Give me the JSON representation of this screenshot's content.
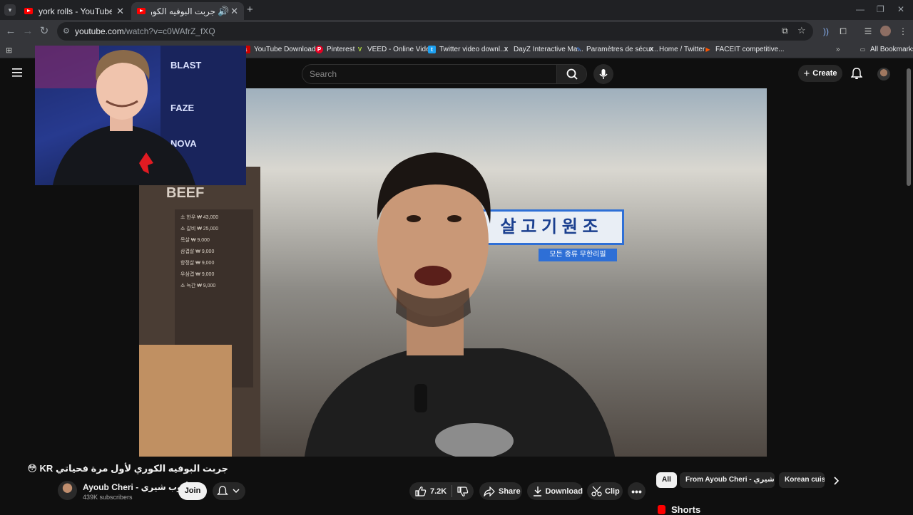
{
  "browser": {
    "tabs": [
      {
        "title": "york rolls - YouTube تحدي أكل",
        "active": false
      },
      {
        "title": "جربت البوفيه الكوري لأول مرة",
        "active": true
      }
    ],
    "url_host": "youtube.com",
    "url_path": "/watch?v=c0WAfrZ_fXQ",
    "bookmarks": [
      {
        "label": "YouTube Download...",
        "icon": "youtube-download-icon",
        "color": "#c00"
      },
      {
        "label": "Pinterest",
        "icon": "pinterest-icon",
        "color": "#e60023"
      },
      {
        "label": "VEED - Online Vide...",
        "icon": "veed-icon",
        "color": "#b6e33d"
      },
      {
        "label": "Twitter video downl...",
        "icon": "twitter-downloader-icon",
        "color": "#1da1f2"
      },
      {
        "label": "DayZ Interactive Ma...",
        "icon": "dayz-icon",
        "color": "#444"
      },
      {
        "label": "Paramètres de sécur...",
        "icon": "security-settings-icon",
        "color": "#4285f4"
      },
      {
        "label": "Home / Twitter",
        "icon": "x-icon",
        "color": "#000"
      },
      {
        "label": "FACEIT competitive...",
        "icon": "faceit-icon",
        "color": "#ff5500"
      }
    ],
    "all_bookmarks": "All Bookmarks"
  },
  "youtube": {
    "search_placeholder": "Search",
    "create_label": "Create"
  },
  "video": {
    "title": "جربت البوفيه الكوري لأول مرة فحياتي KR 😳",
    "scene_text": {
      "beef": "BEEF",
      "sign": "살 고 기 원 조",
      "sign2": "모든 종류 무한리필",
      "menu": [
        "소 한우 ₩ 43,000",
        "소 갈비 ₩ 25,000",
        "목살 ₩ 9,000",
        "삼겹살 ₩ 9,000",
        "항정살 ₩ 9,000",
        "우삼겹 ₩ 9,000",
        "소 늑간 ₩ 9,000"
      ]
    },
    "webcam_text": [
      "BLAST",
      "FAZE",
      "NOVA"
    ]
  },
  "channel": {
    "name": "Ayoub Cheri - أيوب شيري",
    "subscribers": "439K subscribers",
    "join_label": "Join"
  },
  "actions": {
    "likes": "7.2K",
    "share": "Share",
    "download": "Download",
    "clip": "Clip"
  },
  "chips": [
    "All",
    "From Ayoub Cheri - أيوب شيري",
    "Korean cuisine"
  ],
  "shorts_label": "Shorts",
  "colors": {
    "yt_red": "#ff0000",
    "background": "#0f0f0f",
    "chrome_dark": "#202124",
    "chrome_toolbar": "#35363a"
  }
}
